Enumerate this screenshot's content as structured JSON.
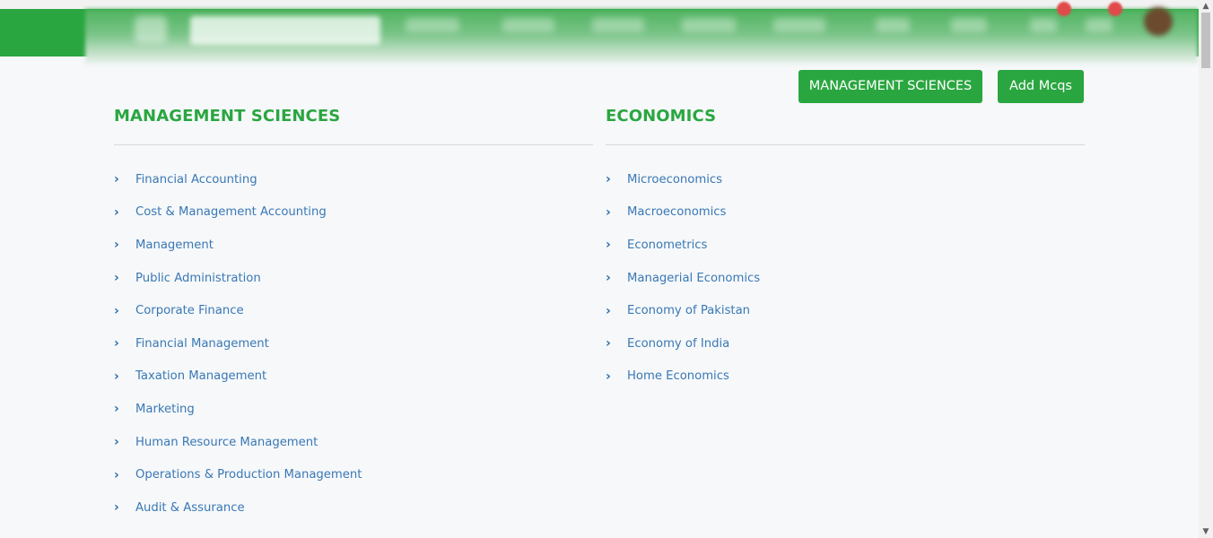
{
  "header": {
    "brand_color": "#2aa640",
    "notification_badges": 2
  },
  "buttons": {
    "management_sciences": "MANAGEMENT SCIENCES",
    "add_mcqs": "Add Mcqs"
  },
  "sections": [
    {
      "title": "MANAGEMENT SCIENCES",
      "items": [
        "Financial Accounting",
        "Cost & Management Accounting",
        "Management",
        "Public Administration",
        "Corporate Finance",
        "Financial Management",
        "Taxation Management",
        "Marketing",
        "Human Resource Management",
        "Operations & Production Management",
        "Audit & Assurance"
      ]
    },
    {
      "title": "ECONOMICS",
      "items": [
        "Microeconomics",
        "Macroeconomics",
        "Econometrics",
        "Managerial Economics",
        "Economy of Pakistan",
        "Economy of India",
        "Home Economics"
      ]
    }
  ],
  "icons": {
    "list_bullet": "chevron-right-icon",
    "chevron_glyph": "›"
  }
}
